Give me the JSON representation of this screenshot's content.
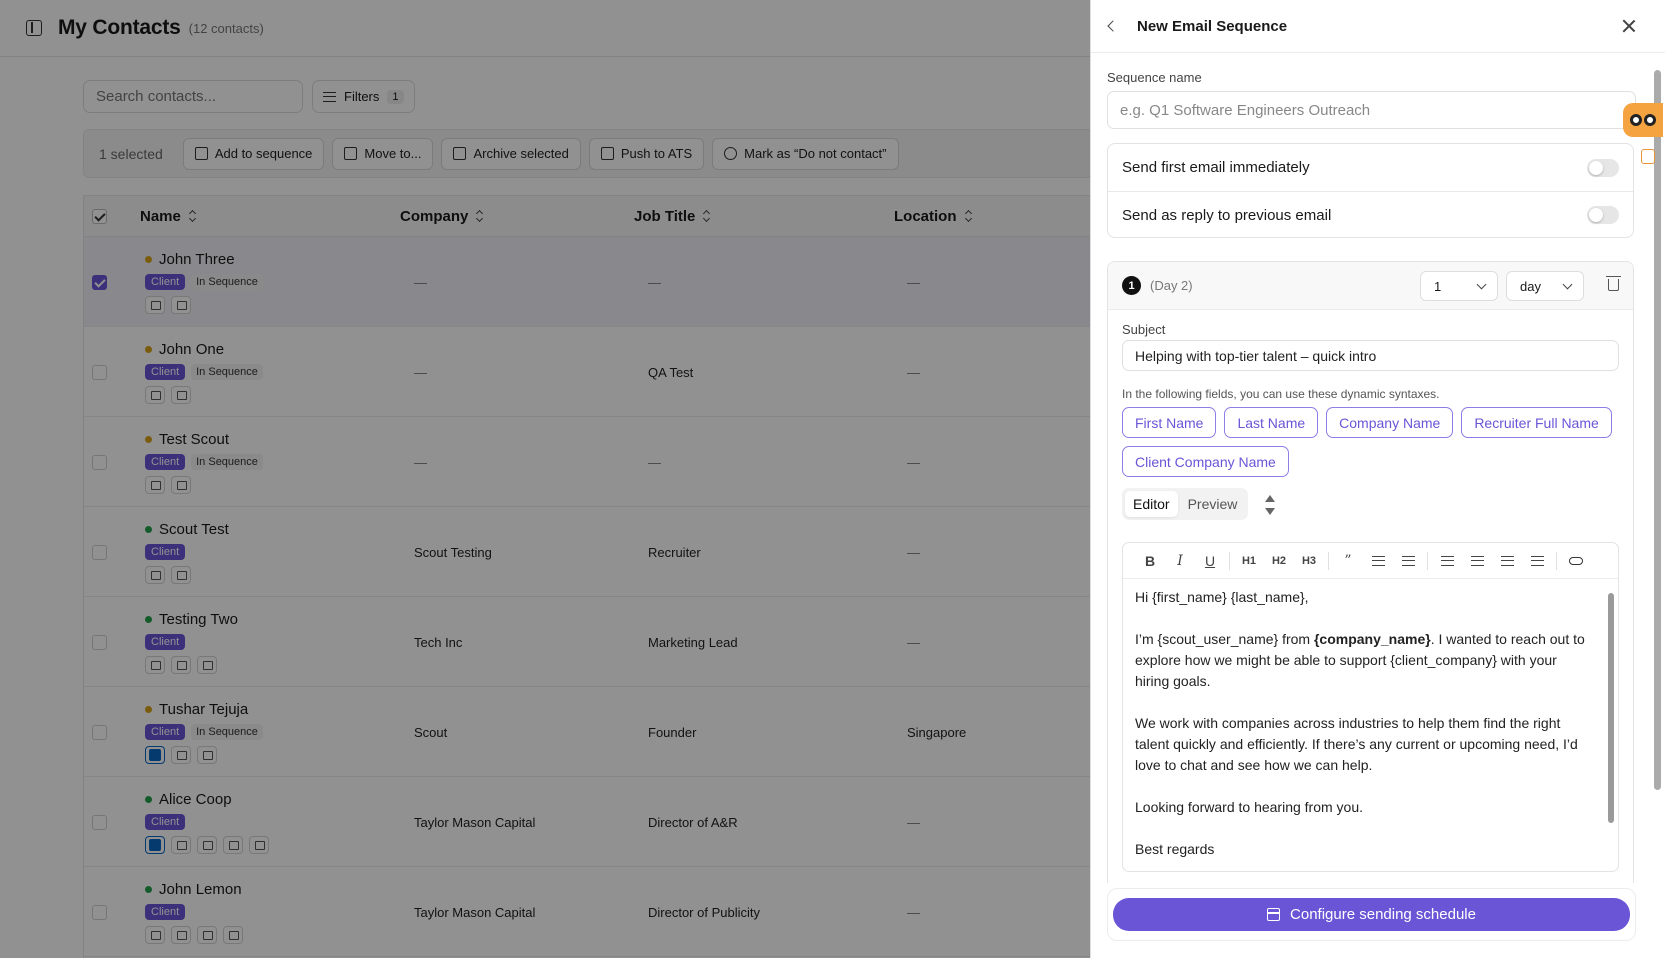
{
  "header": {
    "title": "My Contacts",
    "count": "(12 contacts)"
  },
  "search": {
    "placeholder": "Search contacts..."
  },
  "filters": {
    "label": "Filters",
    "count": "1"
  },
  "action_bar": {
    "selected": "1 selected",
    "add_to_sequence": "Add to sequence",
    "move_to": "Move to...",
    "archive": "Archive selected",
    "push_ats": "Push to ATS",
    "dnc": "Mark as “Do not contact”"
  },
  "table": {
    "columns": [
      "Name",
      "Company",
      "Job Title",
      "Location"
    ],
    "client_tag": "Client",
    "in_sequence_tag": "In Sequence",
    "rows": [
      {
        "name": "John Three",
        "company": "—",
        "title": "—",
        "location": "—"
      },
      {
        "name": "John One",
        "company": "—",
        "title": "QA Test",
        "location": "—"
      },
      {
        "name": "Test Scout",
        "company": "—",
        "title": "—",
        "location": "—"
      },
      {
        "name": "Scout Test",
        "company": "Scout Testing",
        "title": "Recruiter",
        "location": "—"
      },
      {
        "name": "Testing Two",
        "company": "Tech Inc",
        "title": "Marketing Lead",
        "location": "—"
      },
      {
        "name": "Tushar Tejuja",
        "company": "Scout",
        "title": "Founder",
        "location": "Singapore"
      },
      {
        "name": "Alice Coop",
        "company": "Taylor Mason Capital",
        "title": "Director of A&R",
        "location": "—"
      },
      {
        "name": "John Lemon",
        "company": "Taylor Mason Capital",
        "title": "Director of Publicity",
        "location": "—"
      }
    ]
  },
  "colors": {
    "accent": "#6a55d6",
    "dot_orange": "#d9a21b",
    "dot_green": "#22a04b",
    "linkedin": "#0a66c2"
  },
  "drawer": {
    "title": "New Email Sequence",
    "sequence_name_label": "Sequence name",
    "sequence_name_placeholder": "e.g. Q1 Software Engineers Outreach",
    "toggle_immediate": "Send first email immediately",
    "toggle_reply": "Send as reply to previous email",
    "step": {
      "number": "1",
      "day": "(Day 2)",
      "delay_value": "1",
      "delay_unit": "day",
      "subject_label": "Subject",
      "subject_value": "Helping with top-tier talent – quick intro",
      "hint": "In the following fields, you can use these dynamic syntaxes.",
      "chips": [
        "First Name",
        "Last Name",
        "Company Name",
        "Recruiter Full Name",
        "Client Company Name"
      ],
      "tab_editor": "Editor",
      "tab_preview": "Preview",
      "toolbar": {
        "bold": "B",
        "italic": "I",
        "underline": "U",
        "h1": "H1",
        "h2": "H2",
        "h3": "H3",
        "quote": "”"
      },
      "body": {
        "greeting": "Hi {first_name} {last_name},",
        "p1_before": "I’m {scout_user_name} from ",
        "p1_bold": "{company_name}",
        "p1_after": ". I wanted to reach out to explore how we might be able to support {client_company} with your hiring goals.",
        "p2": "We work with companies across industries to help them find the right talent quickly and efficiently. If there’s any current or upcoming need, I’d love to chat and see how we can help.",
        "p3": "Looking forward to hearing from you.",
        "signoff": "Best regards"
      }
    },
    "cta": "Configure sending schedule"
  }
}
